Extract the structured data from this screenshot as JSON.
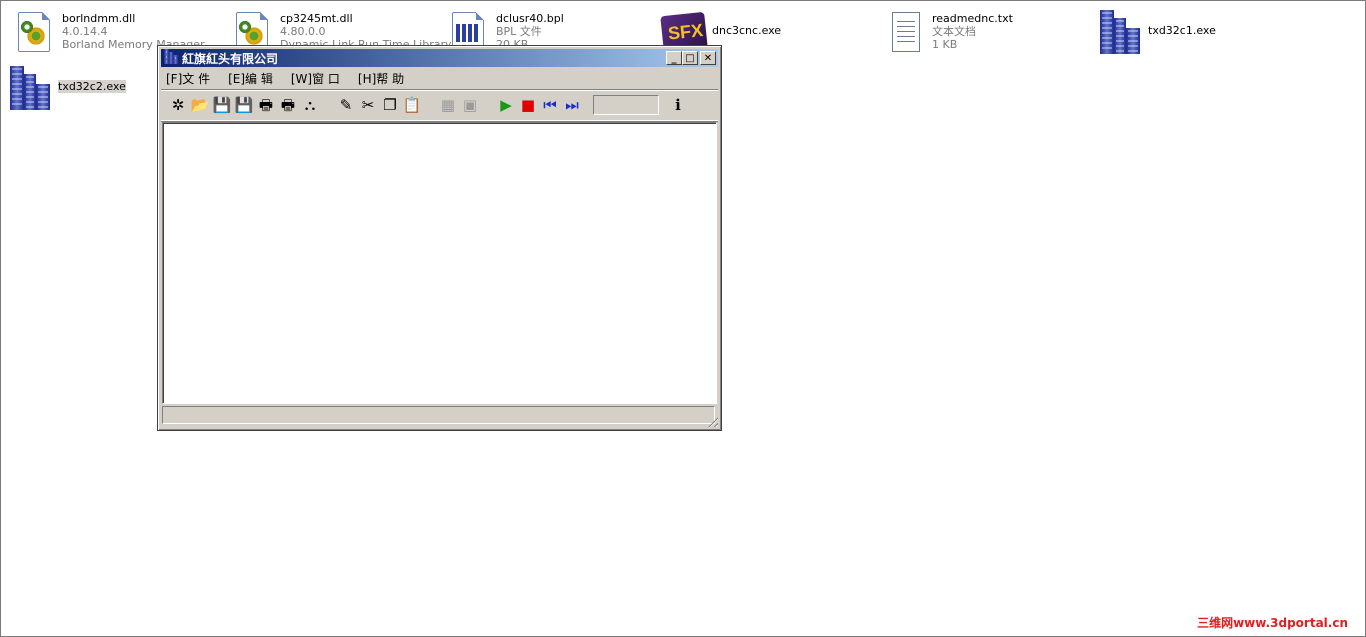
{
  "files": [
    {
      "name": "borlndmm.dll",
      "line2": "4.0.14.4",
      "line3": "Borland Memory Manager"
    },
    {
      "name": "cp3245mt.dll",
      "line2": "4.80.0.0",
      "line3": "Dynamic Link Run Time Library"
    },
    {
      "name": "dclusr40.bpl",
      "line2": "BPL 文件",
      "line3": "20 KB"
    },
    {
      "name": "dnc3cnc.exe",
      "icon_text": "SFX"
    },
    {
      "name": "readmednc.txt",
      "line2": "文本文档",
      "line3": "1 KB"
    },
    {
      "name": "txd32c1.exe"
    },
    {
      "name": "txd32c2.exe"
    }
  ],
  "window": {
    "title": "紅旗紅头有限公司",
    "menu": [
      "[F]文 件",
      "[E]编 辑",
      "[W]窗 口",
      "[H]帮 助"
    ],
    "caption": {
      "minimize": "_",
      "maximize": "□",
      "close": "✕"
    }
  },
  "toolbar_icons": {
    "new": "✲",
    "open": "📂",
    "save": "💾",
    "saveas": "💾",
    "print": "🖶",
    "print_setup": "🖶",
    "exit": "⛬",
    "eraser": "✎",
    "cut": "✂",
    "copy": "❐",
    "paste": "📋",
    "tile": "▦",
    "cascade": "▣",
    "play": "▶",
    "stop": "■",
    "first": "⏮",
    "last": "⏭",
    "help": "ℹ"
  },
  "watermark": "三维网www.3dportal.cn",
  "colors": {
    "titlebar_start": "#0a246a",
    "titlebar_end": "#a6caf0",
    "face": "#d4d0c8",
    "watermark": "#e02020"
  }
}
